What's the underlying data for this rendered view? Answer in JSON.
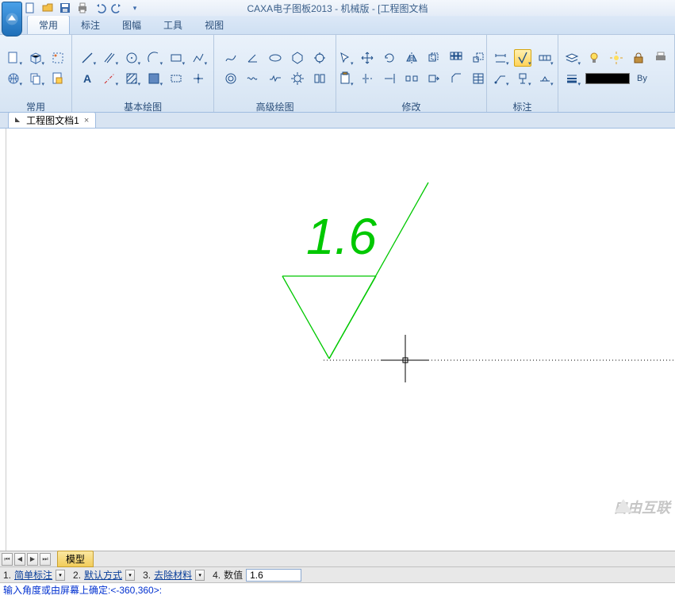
{
  "title": "CAXA电子图板2013 - 机械版 - [工程图文档",
  "qat": [
    "new",
    "open",
    "save",
    "print",
    "undo",
    "redo",
    "more"
  ],
  "menu_tabs": {
    "items": [
      "常用",
      "标注",
      "图幅",
      "工具",
      "视图"
    ],
    "active": 0
  },
  "ribbon": {
    "panels": [
      {
        "name": "常用"
      },
      {
        "name": "基本绘图"
      },
      {
        "name": "高级绘图"
      },
      {
        "name": "修改"
      },
      {
        "name": "标注"
      }
    ],
    "color_label": "By"
  },
  "doc_tab": {
    "label": "工程图文档1"
  },
  "drawing": {
    "value_text": "1.6"
  },
  "model_tab": "模型",
  "options": {
    "o1": {
      "num": "1.",
      "label": "简单标注"
    },
    "o2": {
      "num": "2.",
      "label": "默认方式"
    },
    "o3": {
      "num": "3.",
      "label": "去除材料"
    },
    "o4": {
      "num": "4.",
      "label": "数值",
      "value": "1.6"
    }
  },
  "command_line": "输入角度或由屏幕上确定:<-360,360>:",
  "watermark": "自由互联"
}
